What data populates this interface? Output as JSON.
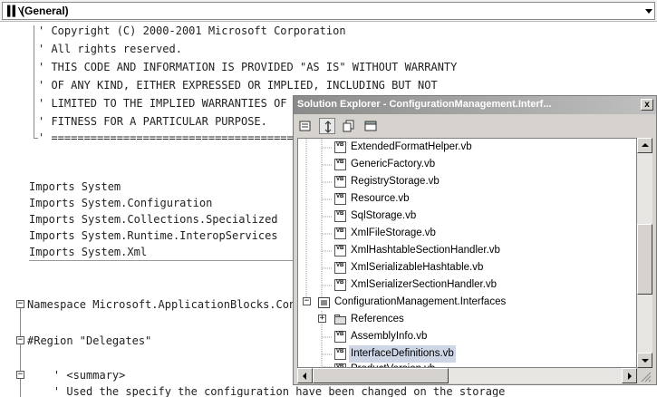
{
  "editor": {
    "proc_combo": {
      "glyph": "▌▌\\",
      "label": "(General)"
    },
    "lines": [
      "' Copyright (C) 2000-2001 Microsoft Corporation",
      "' All rights reserved.",
      "' THIS CODE AND INFORMATION IS PROVIDED \"AS IS\" WITHOUT WARRANTY",
      "' OF ANY KIND, EITHER EXPRESSED OR IMPLIED, INCLUDING BUT NOT",
      "' LIMITED TO THE IMPLIED WARRANTIES OF MERCHANTABILITY AND/OR",
      "' FITNESS FOR A PARTICULAR PURPOSE.",
      "' ==============================================================",
      "",
      "Imports System",
      "Imports System.Configuration",
      "Imports System.Collections.Specialized",
      "Imports System.Runtime.InteropServices",
      "Imports System.Xml",
      "",
      "",
      "Namespace Microsoft.ApplicationBlocks.ConfigurationManagement",
      "",
      "#Region \"Delegates\"",
      "",
      "    ' <summary>",
      "    ' Used the specify the configuration have been changed on the storage"
    ]
  },
  "solution_explorer": {
    "title": "Solution Explorer - ConfigurationManagement.Interf...",
    "close_glyph": "x",
    "toolbar": [
      "properties-icon",
      "refresh-icon",
      "show-all-files-icon",
      "view-code-icon"
    ],
    "file_badge": "VB",
    "items": [
      {
        "label": "ExtendedFormatHelper.vb",
        "type": "vb-file"
      },
      {
        "label": "GenericFactory.vb",
        "type": "vb-file"
      },
      {
        "label": "RegistryStorage.vb",
        "type": "vb-file"
      },
      {
        "label": "Resource.vb",
        "type": "vb-file"
      },
      {
        "label": "SqlStorage.vb",
        "type": "vb-file"
      },
      {
        "label": "XmlFileStorage.vb",
        "type": "vb-file"
      },
      {
        "label": "XmlHashtableSectionHandler.vb",
        "type": "vb-file"
      },
      {
        "label": "XmlSerializableHashtable.vb",
        "type": "vb-file"
      },
      {
        "label": "XmlSerializerSectionHandler.vb",
        "type": "vb-file"
      },
      {
        "label": "ConfigurationManagement.Interfaces",
        "type": "project"
      },
      {
        "label": "References",
        "type": "references"
      },
      {
        "label": "AssemblyInfo.vb",
        "type": "vb-file"
      },
      {
        "label": "InterfaceDefinitions.vb",
        "type": "vb-file",
        "selected": true
      },
      {
        "label": "ProductVersion.vb",
        "type": "vb-file"
      }
    ]
  }
}
